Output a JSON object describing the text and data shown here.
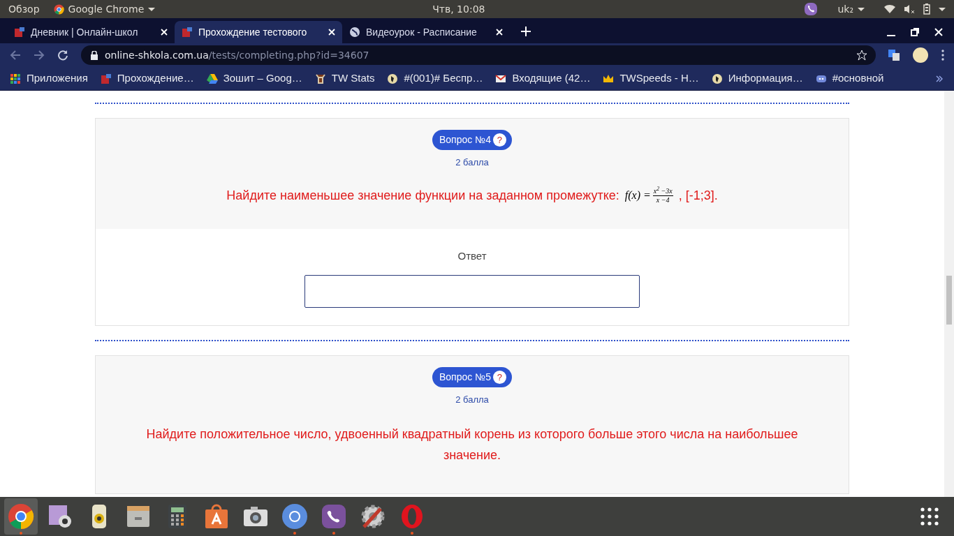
{
  "top_bar": {
    "activities": "Обзор",
    "app_menu": "Google Chrome",
    "clock": "Чтв, 10:08",
    "keyboard_layout": "uk₂"
  },
  "tabs": [
    {
      "title": "Дневник | Онлайн-школ",
      "selected": false
    },
    {
      "title": "Прохождение тестового",
      "selected": true
    },
    {
      "title": "Видеоурок - Расписание",
      "selected": false
    }
  ],
  "address_bar": {
    "host": "online-shkola.com.ua",
    "path": "/tests/completing.php?id=34607"
  },
  "bookmarks": [
    {
      "label": "Приложения"
    },
    {
      "label": "Прохождение…"
    },
    {
      "label": "Зошит – Goog…"
    },
    {
      "label": "TW Stats"
    },
    {
      "label": "#(001)# Беспр…"
    },
    {
      "label": "Входящие (42…"
    },
    {
      "label": "TWSpeeds - H…"
    },
    {
      "label": "Информация…"
    },
    {
      "label": "#основной"
    }
  ],
  "questions": [
    {
      "badge": "Вопрос №4",
      "help": "?",
      "points": "2 балла",
      "text": "Найдите наименьшее значение функции на заданном промежутке:",
      "formula": {
        "lhs": "f(x) =",
        "numerator": "x$^{2}$ −3x",
        "denominator": "x −4"
      },
      "suffix": ", [-1;3].",
      "answer_label": "Ответ"
    },
    {
      "badge": "Вопрос №5",
      "help": "?",
      "points": "2 балла",
      "text": "Найдите положительное число, удвоенный квадратный корень из которого больше этого числа на наибольшее значение."
    }
  ],
  "dock": [
    {
      "running": true,
      "selected": true
    },
    {
      "running": false,
      "selected": false
    },
    {
      "running": false,
      "selected": false
    },
    {
      "running": false,
      "selected": false
    },
    {
      "running": false,
      "selected": false
    },
    {
      "running": false,
      "selected": false
    },
    {
      "running": false,
      "selected": false
    },
    {
      "running": true,
      "selected": false
    },
    {
      "running": true,
      "selected": false
    },
    {
      "running": false,
      "selected": false
    },
    {
      "running": true,
      "selected": false
    }
  ]
}
